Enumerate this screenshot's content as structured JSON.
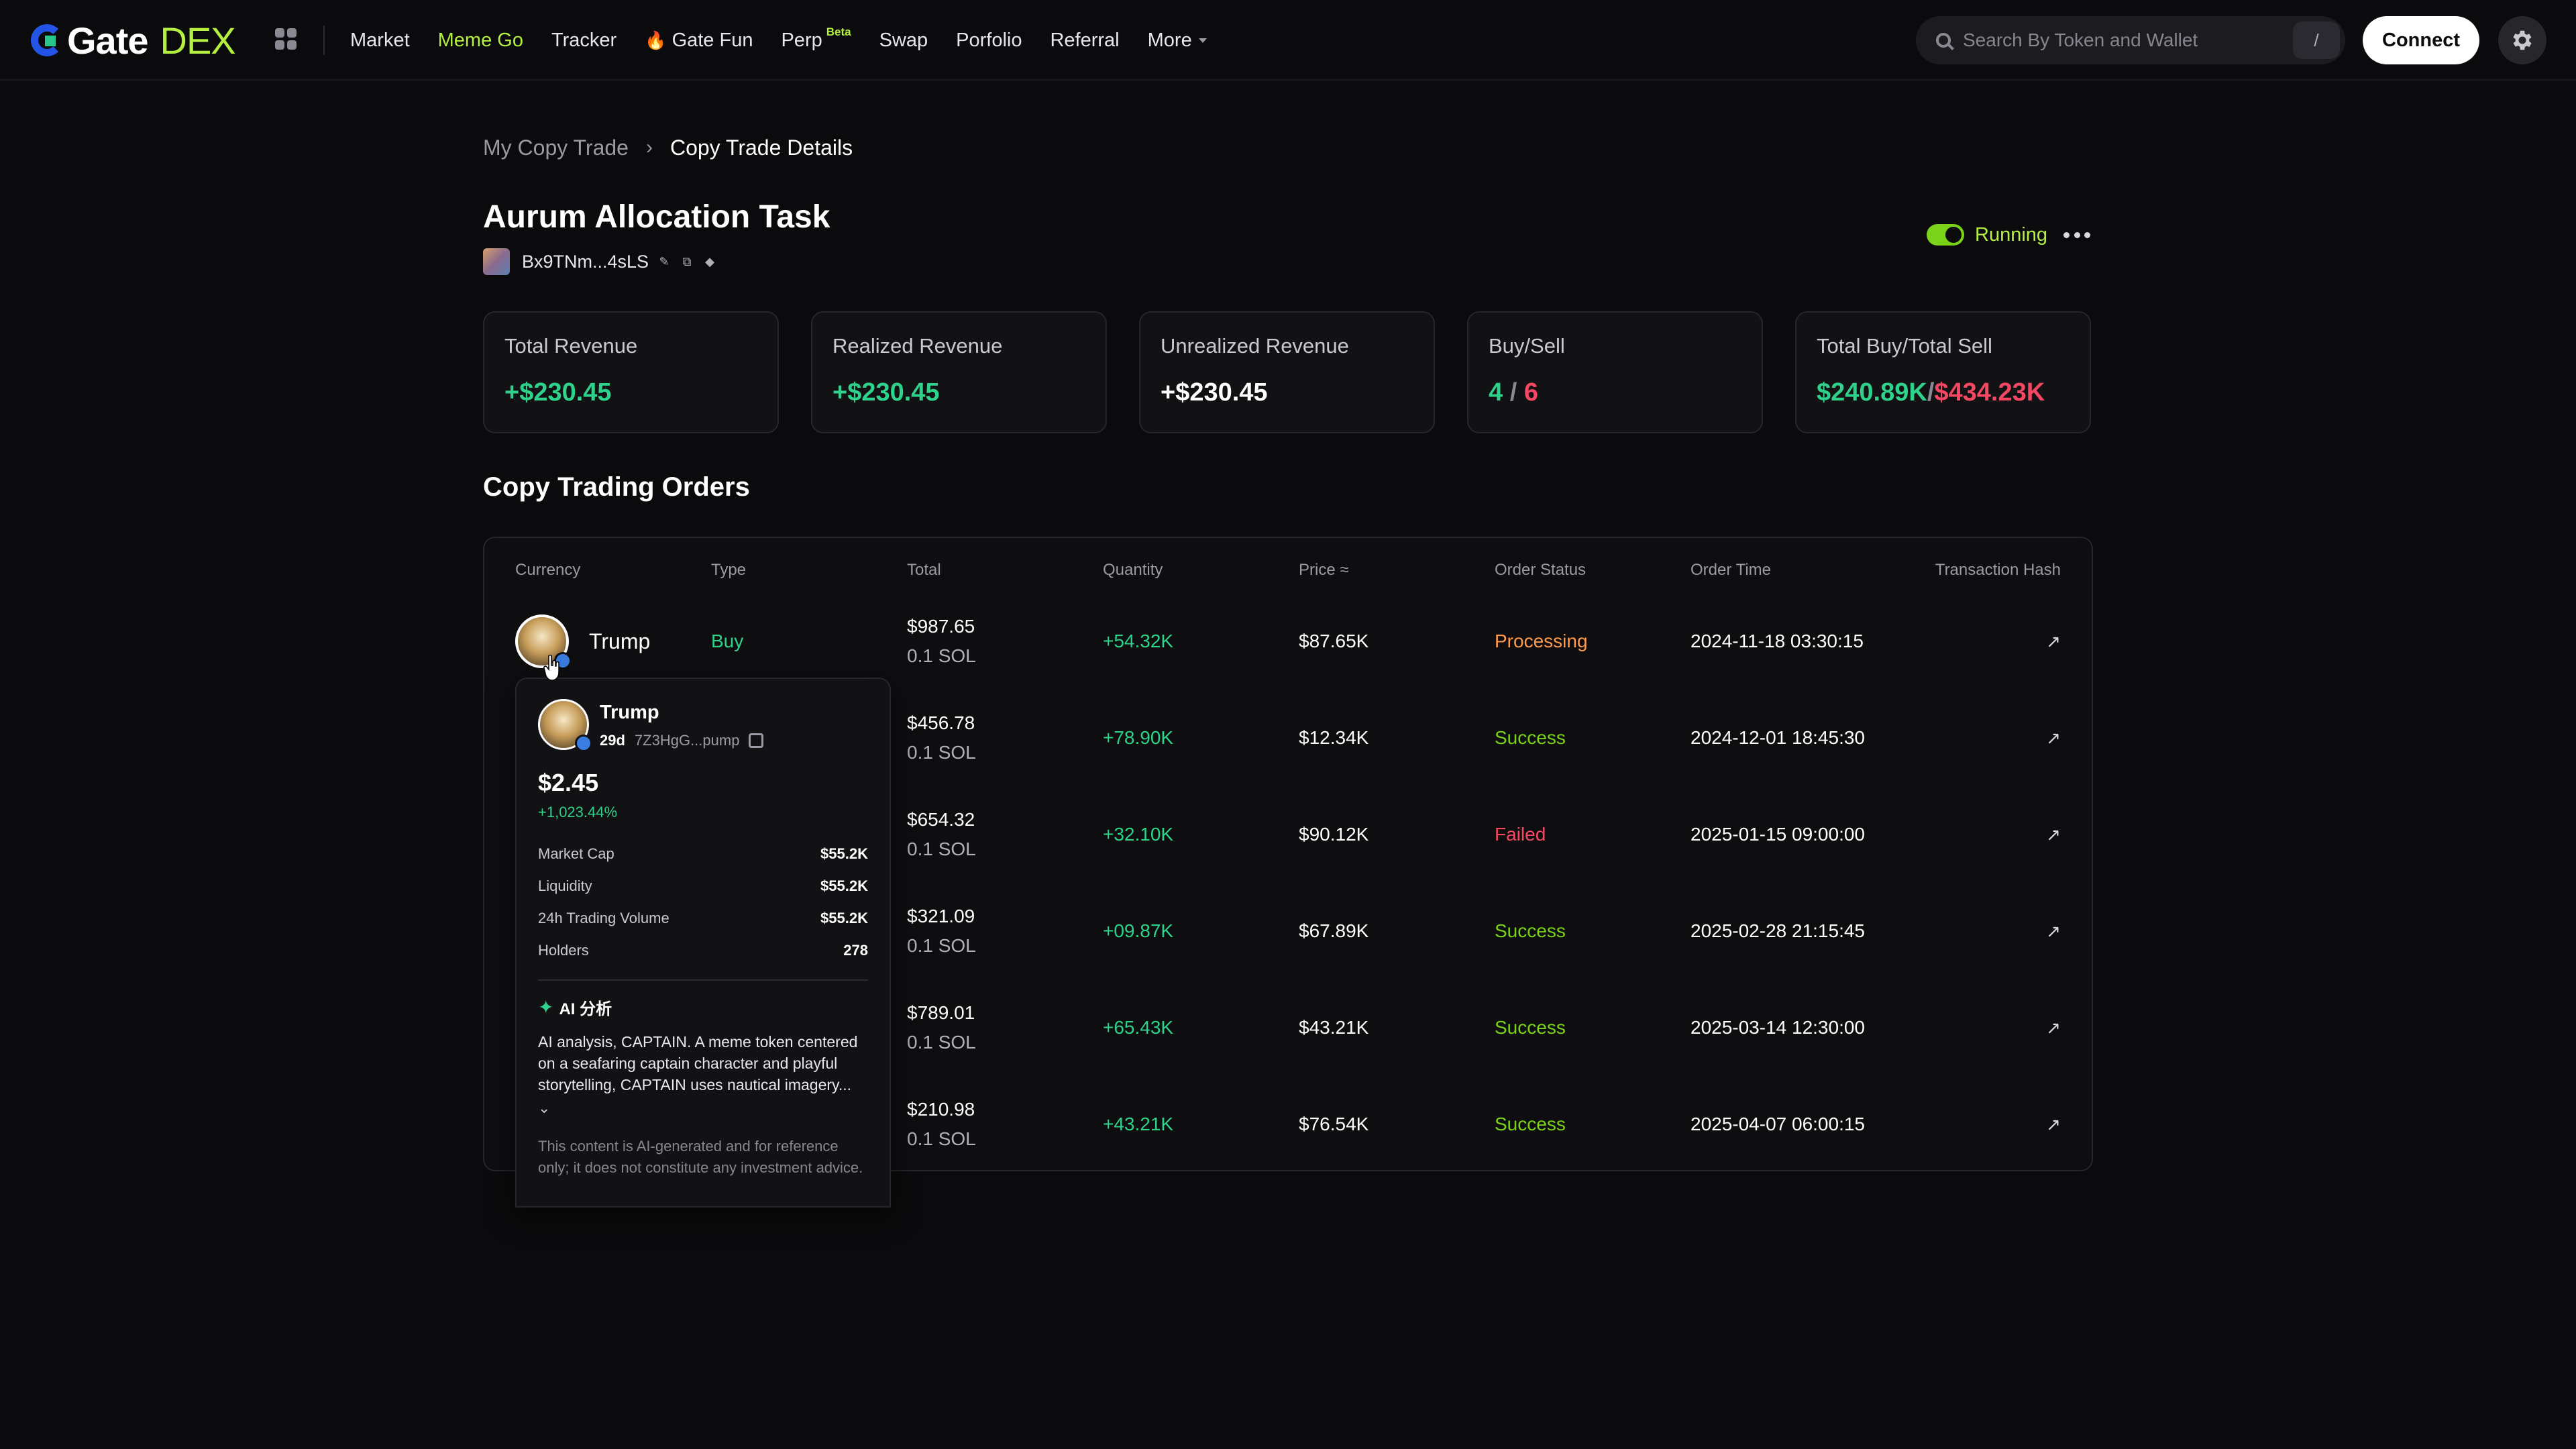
{
  "nav": {
    "logo_gate": "Gate",
    "logo_dex": "DEX",
    "menu": [
      {
        "label": "Market",
        "active": false
      },
      {
        "label": "Meme Go",
        "active": true
      },
      {
        "label": "Tracker",
        "active": false
      },
      {
        "label": "Gate Fun",
        "active": false
      },
      {
        "label": "Perp",
        "active": false
      },
      {
        "label": "Swap",
        "active": false
      },
      {
        "label": "Porfolio",
        "active": false
      },
      {
        "label": "Referral",
        "active": false
      },
      {
        "label": "More",
        "active": false
      }
    ],
    "perp_badge": "Beta",
    "search_placeholder": "Search By Token and Wallet",
    "search_shortcut": "/",
    "connect_label": "Connect"
  },
  "breadcrumb": {
    "prev": "My Copy Trade",
    "current": "Copy Trade Details"
  },
  "task": {
    "title": "Aurum Allocation Task",
    "wallet": "Bx9TNm...4sLS",
    "status": "Running"
  },
  "stats": [
    {
      "label": "Total Revenue",
      "value": "+$230.45"
    },
    {
      "label": "Realized Revenue",
      "value": "+$230.45"
    },
    {
      "label": "Unrealized Revenue",
      "value": "+$230.45"
    },
    {
      "label": "Buy/Sell",
      "buy": "4",
      "sep": " / ",
      "sell": "6"
    },
    {
      "label": "Total Buy/Total Sell",
      "buy": "$240.89K",
      "sep": "/",
      "sell": "$434.23K"
    }
  ],
  "orders": {
    "section_title": "Copy Trading Orders",
    "columns": [
      "Currency",
      "Type",
      "Total",
      "Quantity",
      "Price ≈",
      "Order Status",
      "Order Time",
      "Transaction Hash"
    ],
    "rows": [
      {
        "currency": "Trump",
        "type": "Buy",
        "total": "$987.65",
        "total_sol": "0.1 SOL",
        "quantity": "+54.32K",
        "price": "$87.65K",
        "status": "Processing",
        "status_kind": "processing",
        "time": "2024-11-18 03:30:15"
      },
      {
        "currency": "",
        "type": "",
        "total": "$456.78",
        "total_sol": "0.1 SOL",
        "quantity": "+78.90K",
        "price": "$12.34K",
        "status": "Success",
        "status_kind": "success",
        "time": "2024-12-01 18:45:30"
      },
      {
        "currency": "",
        "type": "",
        "total": "$654.32",
        "total_sol": "0.1 SOL",
        "quantity": "+32.10K",
        "price": "$90.12K",
        "status": "Failed",
        "status_kind": "failed",
        "time": "2025-01-15 09:00:00"
      },
      {
        "currency": "",
        "type": "",
        "total": "$321.09",
        "total_sol": "0.1 SOL",
        "quantity": "+09.87K",
        "price": "$67.89K",
        "status": "Success",
        "status_kind": "success",
        "time": "2025-02-28 21:15:45"
      },
      {
        "currency": "",
        "type": "",
        "total": "$789.01",
        "total_sol": "0.1 SOL",
        "quantity": "+65.43K",
        "price": "$43.21K",
        "status": "Success",
        "status_kind": "success",
        "time": "2025-03-14 12:30:00"
      },
      {
        "currency": "",
        "type": "",
        "total": "$210.98",
        "total_sol": "0.1 SOL",
        "quantity": "+43.21K",
        "price": "$76.54K",
        "status": "Success",
        "status_kind": "success",
        "time": "2025-04-07 06:00:15"
      }
    ],
    "hash_icon": "↗"
  },
  "popup": {
    "name": "Trump",
    "age": "29d",
    "address": "7Z3HgG...pump",
    "price": "$2.45",
    "change": "+1,023.44%",
    "stats": [
      {
        "label": "Market Cap",
        "value": "$55.2K"
      },
      {
        "label": "Liquidity",
        "value": "$55.2K"
      },
      {
        "label": "24h Trading Volume",
        "value": "$55.2K"
      },
      {
        "label": "Holders",
        "value": "278"
      }
    ],
    "ai_title": "AI 分析",
    "ai_text": "AI analysis, CAPTAIN. A meme token centered on a seafaring captain character and playful storytelling, CAPTAIN uses nautical imagery...",
    "disclaimer": "This content is AI-generated and for reference only; it does not constitute any investment advice."
  },
  "colors": {
    "accent": "#b4f040",
    "positive": "#2fd28a",
    "negative": "#f44763",
    "processing": "#ff9a4a",
    "success": "#7ad318",
    "background": "#0b0b0d"
  },
  "icons": [
    "gate-logo-icon",
    "apps-grid-icon",
    "fire-icon",
    "search-icon",
    "gear-icon",
    "edit-icon",
    "copy-icon",
    "diamond-icon",
    "more-dots-icon",
    "chevron-right-icon",
    "sparkle-icon",
    "chevron-down-icon",
    "external-link-icon",
    "cursor-icon"
  ]
}
